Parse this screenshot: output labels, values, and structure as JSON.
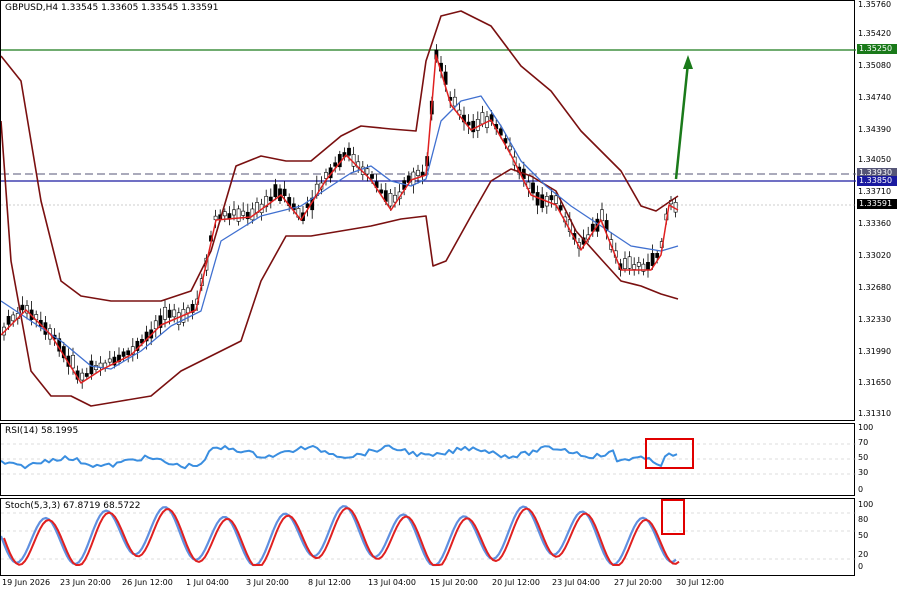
{
  "symbol_title": "GBPUSD,H4  1.33545 1.33605 1.33545 1.33591",
  "price_axis": [
    "1.35760",
    "1.35420",
    "1.35080",
    "1.34740",
    "1.34390",
    "1.34050",
    "1.33710",
    "1.33360",
    "1.33020",
    "1.32680",
    "1.32330",
    "1.31990",
    "1.31650",
    "1.31310"
  ],
  "price_tags": [
    {
      "label": "1.35250",
      "color": "#1a7a1a"
    },
    {
      "label": "1.33930",
      "color": "#555577"
    },
    {
      "label": "1.33850",
      "color": "#1a1aa0"
    },
    {
      "label": "1.33591",
      "color": "#000000"
    }
  ],
  "rsi_panel": {
    "title": "RSI(14) 58.1995",
    "axis": [
      "100",
      "70",
      "50",
      "30",
      "0"
    ]
  },
  "stoch_panel": {
    "title": "Stoch(5,3,3) 67.8719 68.5722",
    "axis": [
      "100",
      "80",
      "50",
      "20",
      "0"
    ]
  },
  "time_axis": [
    "19 Jun 2026",
    "23 Jun 20:00",
    "26 Jun 12:00",
    "1 Jul 04:00",
    "3 Jul 20:00",
    "8 Jul 12:00",
    "13 Jul 04:00",
    "15 Jul 20:00",
    "20 Jul 12:00",
    "23 Jul 04:00",
    "27 Jul 20:00",
    "30 Jul 12:00"
  ],
  "colors": {
    "resistance": "#1a7a1a",
    "support": "#1a1aa0",
    "upper_dash": "#555577",
    "candles": "#000000",
    "bands": "#7a1010",
    "fast_ma": "#e02020",
    "slow_ma": "#4070d0",
    "rsi": "#3a8ee0",
    "stoch_k": "#6090e0",
    "stoch_d": "#e02020",
    "highlight": "#e00000",
    "arrow": "#1a7a1a"
  }
}
